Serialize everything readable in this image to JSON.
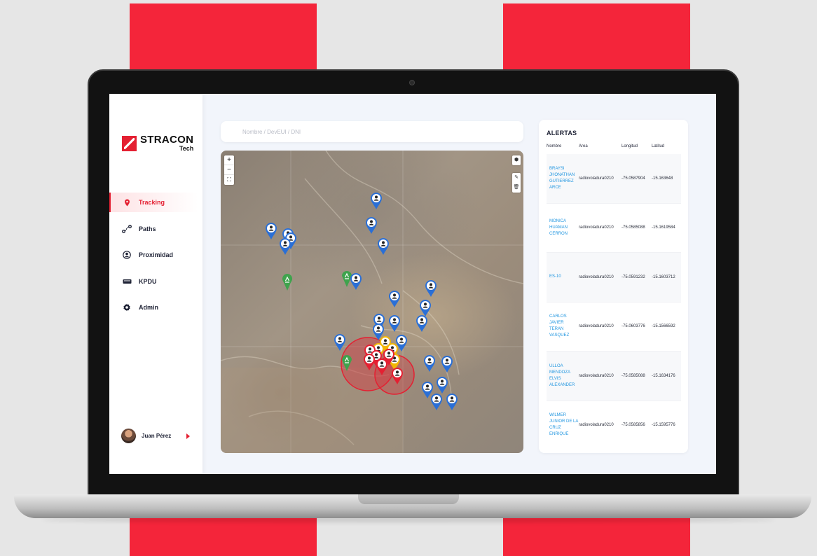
{
  "app": {
    "brand": "STRACON",
    "brand_sub": "Tech",
    "accent_color": "#e42032",
    "link_color": "#2196e0"
  },
  "sidebar": {
    "items": [
      {
        "label": "Tracking",
        "icon": "map-pin-icon",
        "active": true
      },
      {
        "label": "Paths",
        "icon": "route-icon",
        "active": false
      },
      {
        "label": "Proximidad",
        "icon": "user-circle-icon",
        "active": false
      },
      {
        "label": "KPDU",
        "icon": "device-icon",
        "active": false
      },
      {
        "label": "Admin",
        "icon": "gear-icon",
        "active": false
      }
    ],
    "user": {
      "name": "Juan Pérez"
    }
  },
  "search": {
    "placeholder": "Nombre / DevEUI / DNI",
    "value": ""
  },
  "map": {
    "controls": {
      "zoom_in": "+",
      "zoom_out": "−"
    },
    "marker_colors": {
      "worker": "#2a6fd6",
      "alert": "#e42032",
      "station": "#3fa34d",
      "caution": "#f2b705"
    }
  },
  "alerts": {
    "title": "ALERTAS",
    "columns": [
      "Nombre",
      "Area",
      "Longitud",
      "Latitud"
    ],
    "rows": [
      {
        "name": "BRAYSI JHONATHAN GUTIERREZ ARCE",
        "area": "radiovoladura0210",
        "lon": "-75.0587904",
        "lat": "-15.163648"
      },
      {
        "name": "MONICA HUAMAN CERRON",
        "area": "radiovoladura0210",
        "lon": "-75.0585088",
        "lat": "-15.1619584"
      },
      {
        "name": "ES-10",
        "area": "radiovoladura0210",
        "lon": "-75.0591232",
        "lat": "-15.1603712"
      },
      {
        "name": "CARLOS JAVIER TERAN VASQUEZ",
        "area": "radiovoladura0210",
        "lon": "-75.0603776",
        "lat": "-15.1566592"
      },
      {
        "name": "ULLOA MENDOZA ELVIS ALEXANDER",
        "area": "radiovoladura0210",
        "lon": "-75.0585088",
        "lat": "-15.1634176"
      },
      {
        "name": "WILMER JUNIOR DE LA CRUZ ENRIQUE",
        "area": "radiovoladura0210",
        "lon": "-75.0585856",
        "lat": "-15.1595776"
      }
    ]
  }
}
